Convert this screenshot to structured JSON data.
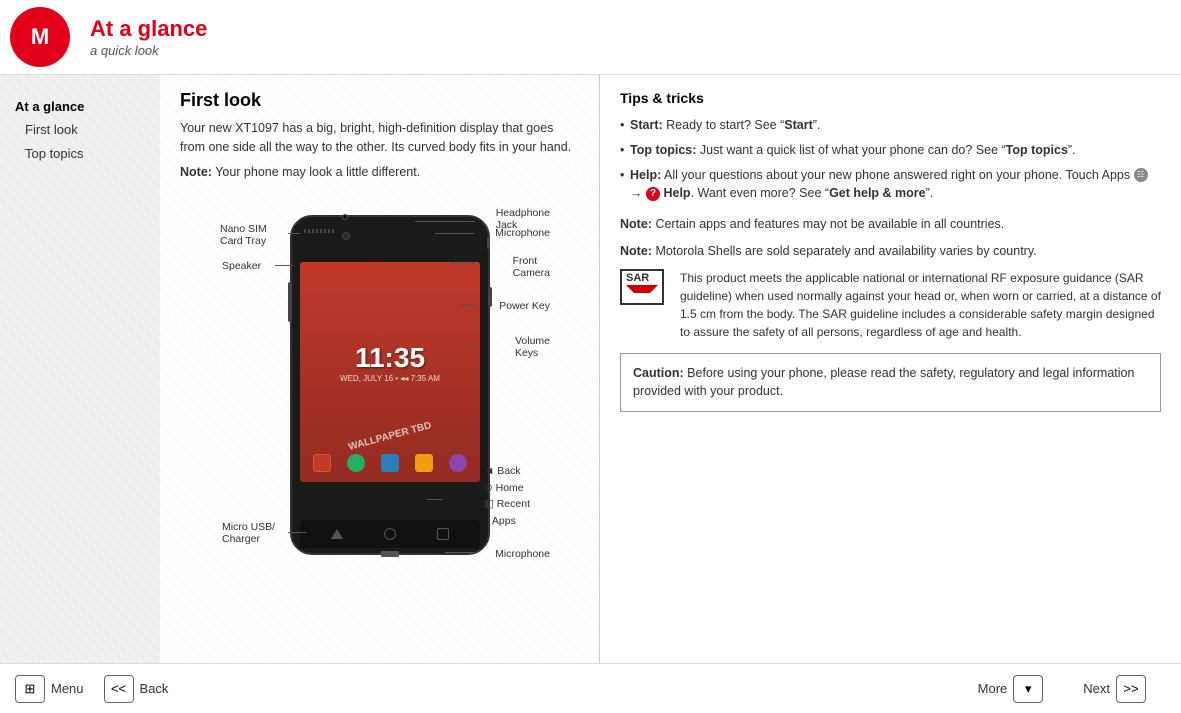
{
  "header": {
    "title": "At a glance",
    "subtitle": "a quick look",
    "logo_alt": "Motorola logo"
  },
  "sidebar": {
    "items": [
      {
        "label": "At a glance",
        "active": true,
        "sub": false
      },
      {
        "label": "First look",
        "active": false,
        "sub": true
      },
      {
        "label": "Top topics",
        "active": false,
        "sub": true
      }
    ]
  },
  "left_panel": {
    "title": "First look",
    "body1": "Your new XT1097 has a big, bright, high-definition display that goes from one side all the way to the other. Its curved body fits in your hand.",
    "note": "Note:",
    "note_text": "Your phone may look a little different.",
    "phone": {
      "time": "11:35",
      "date": "WED, JULY 16  •  ◂◂ 7:35 AM",
      "wallpaper": "WALLPAPER TBD"
    },
    "labels": {
      "headphone_jack": "Headphone\nJack",
      "microphone_top": "Microphone",
      "nano_sim": "Nano SIM\nCard Tray",
      "front_camera": "Front\nCamera",
      "speaker": "Speaker",
      "power_key": "Power Key",
      "volume_keys": "Volume\nKeys",
      "back": "◄ Back",
      "home": "⊙ Home",
      "recent_apps": "◧ Recent\n   Apps",
      "micro_usb": "Micro USB/\nCharger",
      "microphone_bottom": "Microphone"
    }
  },
  "right_panel": {
    "tips_title": "Tips & tricks",
    "tips": [
      {
        "label": "Start:",
        "text": " Ready to start? See “",
        "link": "Start",
        "text2": "”."
      },
      {
        "label": "Top topics:",
        "text": " Just want a quick list of what your phone can do? See “",
        "link": "Top topics",
        "text2": "”."
      },
      {
        "label": "Help:",
        "text": " All your questions about your new phone answered right on your phone. Touch Apps ",
        "icon_apps": true,
        "text3": " → ",
        "icon_help": true,
        "text4": " Help",
        "text5": ". Want even more? See “",
        "link": "Get help & more",
        "text6": "”."
      }
    ],
    "note1_label": "Note:",
    "note1_text": " Certain apps and features may not be available in all countries.",
    "note2_label": "Note:",
    "note2_text": " Motorola Shells are sold separately and availability varies by country.",
    "sar_text": "This product meets the applicable national or international RF exposure guidance (SAR guideline) when used normally against your head or, when worn or carried, at a distance of 1.5 cm from the body. The SAR guideline includes a considerable safety margin designed to assure the safety of all persons, regardless of age and health.",
    "caution_label": "Caution:",
    "caution_text": " Before using your phone, please read the safety, regulatory and legal information provided with your product."
  },
  "footer": {
    "menu_label": "Menu",
    "back_label": "Back",
    "more_label": "More",
    "next_label": "Next",
    "menu_icon": "⊞",
    "back_icon": "<<",
    "more_icon": "▾",
    "next_icon": ">>"
  }
}
